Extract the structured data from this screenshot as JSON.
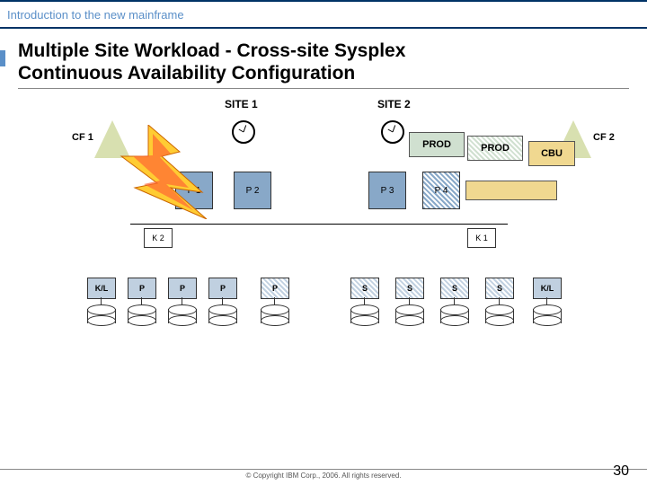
{
  "header": {
    "breadcrumb": "Introduction to the new mainframe"
  },
  "title_line1": "Multiple Site Workload - Cross-site Sysplex",
  "title_line2": "Continuous Availability Configuration",
  "labels": {
    "site1": "SITE 1",
    "site2": "SITE 2",
    "cf1": "CF 1",
    "cf2": "CF 2",
    "prod": "PROD",
    "cbu": "CBU",
    "p1": "P 1",
    "p2": "P 2",
    "p3": "P 3",
    "p4": "P 4",
    "k1": "K 1",
    "k2": "K 2",
    "kl": "K/L",
    "p": "P",
    "s": "S"
  },
  "footer": {
    "copyright": "© Copyright IBM Corp., 2006. All rights reserved.",
    "page": "30"
  }
}
